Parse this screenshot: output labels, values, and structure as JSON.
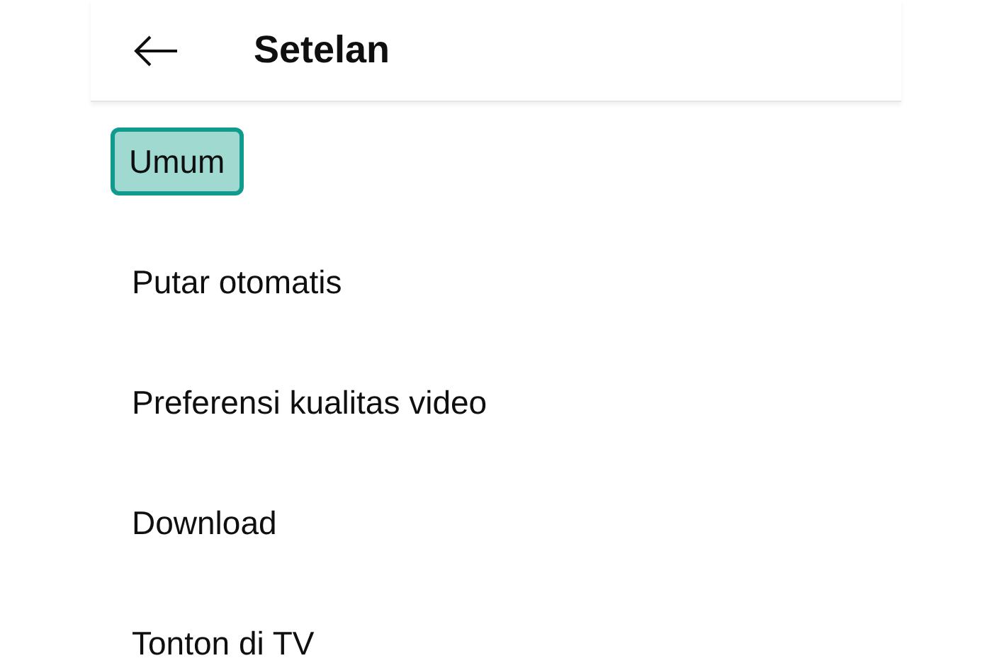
{
  "header": {
    "title": "Setelan"
  },
  "items": [
    {
      "label": "Umum",
      "selected": true
    },
    {
      "label": "Putar otomatis",
      "selected": false
    },
    {
      "label": "Preferensi kualitas video",
      "selected": false
    },
    {
      "label": "Download",
      "selected": false
    },
    {
      "label": "Tonton di TV",
      "selected": false
    }
  ]
}
